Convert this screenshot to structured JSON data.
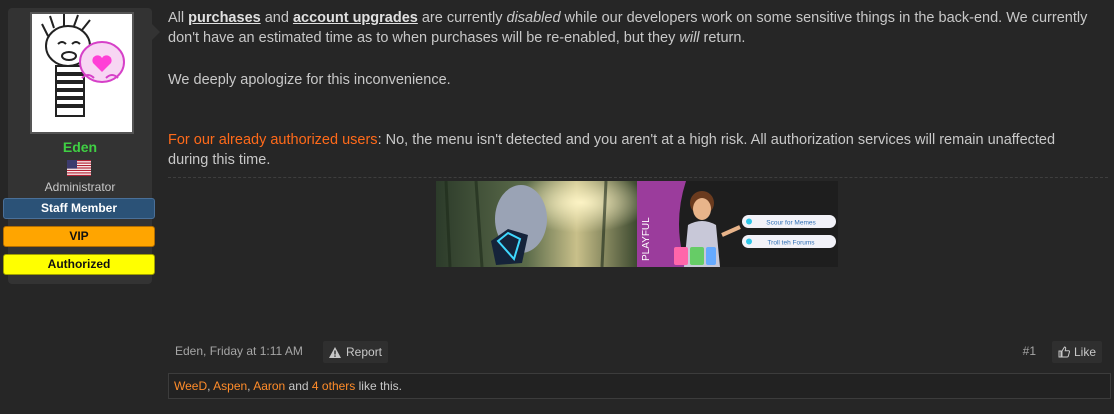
{
  "user": {
    "name": "Eden",
    "title": "Administrator",
    "banners": {
      "staff": "Staff Member",
      "vip": "VIP",
      "authorized": "Authorized"
    }
  },
  "message": {
    "p1": {
      "t1": "All ",
      "link1": "purchases",
      "t2": " and ",
      "link2": "account upgrades",
      "t3": " are currently ",
      "em1": "disabled",
      "t4": " while our developers work on some sensitive things in the back-end. We currently don't have an estimated time as to when purchases will be re-enabled, but they ",
      "em2": "will",
      "t5": " return."
    },
    "p2": "We deeply apologize for this inconvenience.",
    "p3": {
      "highlight": "For our already authorized users",
      "rest": ": No, the menu isn't detected and you aren't at a high risk. All authorization services will remain unaffected during this time."
    }
  },
  "signature": {
    "side_label": "PLAYFUL",
    "button1": "Scour for Memes",
    "button2": "Troll teh Forums"
  },
  "footer": {
    "author_date": "Eden, Friday at 1:11 AM",
    "report": "Report",
    "post_number": "#1",
    "like": "Like"
  },
  "likes": {
    "users": [
      "WeeD",
      "Aspen",
      "Aaron"
    ],
    "sep1": ", ",
    "sep2": ", ",
    "and": " and ",
    "others": "4 others",
    "suffix": " like this."
  },
  "colors": {
    "username": "#3fcf43",
    "highlight": "#ff6a1a",
    "liker": "#ff8c2a",
    "staff_banner": "#2b5277",
    "vip_banner": "#ffa500",
    "authorized_banner": "#ffff00"
  }
}
